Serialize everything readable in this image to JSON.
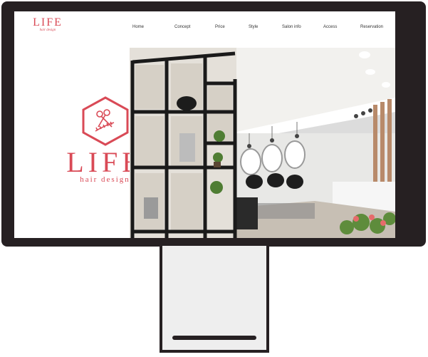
{
  "site": {
    "logo_word": "LIFE",
    "logo_sub": "hair design"
  },
  "nav": {
    "items": [
      "Home",
      "Concept",
      "Price",
      "Style",
      "Salon info",
      "Access",
      "Reservation"
    ]
  },
  "hero": {
    "logo_word": "LIFE",
    "logo_sub": "hair design",
    "emblem_icon": "scissors-and-comb-hexagon-icon"
  },
  "photo": {
    "subject": "salon-interior-photo"
  },
  "colors": {
    "brand": "#d94a56",
    "bezel": "#262022",
    "stand": "#eeeeee"
  }
}
